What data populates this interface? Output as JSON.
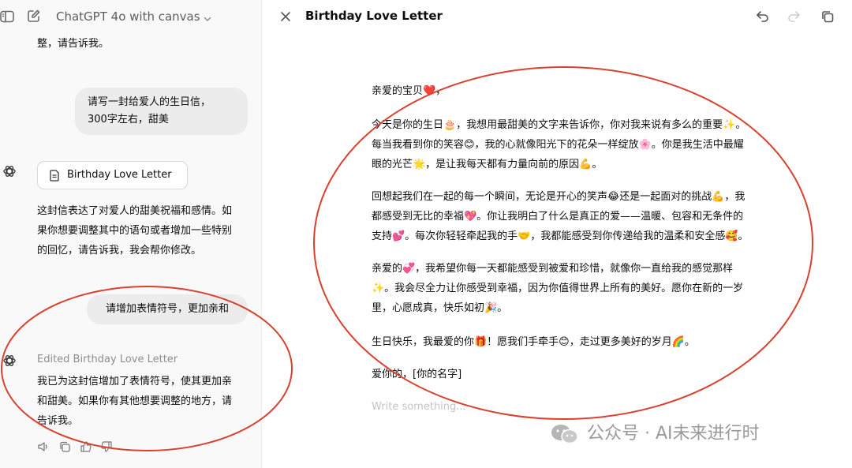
{
  "chat": {
    "model_name": "ChatGPT 4o with canvas",
    "prev_message_tail": "整，请告诉我。",
    "messages": {
      "user_1": [
        "请写一封给爱人的生日信，",
        "300字左右，甜美"
      ],
      "doc_card_label": "Birthday Love Letter",
      "assistant_1": [
        "这封信表达了对爱人的甜美祝福和感情。如",
        "果你想要调整其中的语句或者增加一些特别",
        "的回忆，请告诉我，我会帮你修改。"
      ],
      "user_2": "请增加表情符号，更加亲和",
      "edited_label": "Edited Birthday Love Letter",
      "assistant_2": [
        "我已为这封信增加了表情符号，使其更加亲",
        "和甜美。如果你有其他想要调整的地方，请",
        "告诉我。"
      ]
    },
    "actions": [
      "speaker-icon",
      "copy-icon",
      "thumbs-up-icon",
      "thumbs-down-icon"
    ]
  },
  "canvas": {
    "title": "Birthday Love Letter",
    "letter": {
      "greeting": "亲爱的宝贝❤️，",
      "p1": [
        "今天是你的生日🎂，我想用最甜美的文字来告诉你，你对我来说有多么的重要✨。",
        "每当我看到你的笑容😊，我的心就像阳光下的花朵一样绽放🌸。你是我生活中最耀",
        "眼的光芒🌟，是让我每天都有力量向前的原因💪。"
      ],
      "p2": [
        "回想起我们在一起的每一个瞬间，无论是开心的笑声😂还是一起面对的挑战💪，我",
        "都感受到无比的幸福💖。你让我明白了什么是真正的爱——温暖、包容和无条件的",
        "支持💕。每次你轻轻牵起我的手🤝，我都能感受到你传递给我的温柔和安全感🥰。"
      ],
      "p3": [
        "亲爱的💞，我希望你每一天都能感受到被爱和珍惜，就像你一直给我的感觉那样",
        "✨。我会尽全力让你感受到幸福，因为你值得世界上所有的美好。愿你在新的一岁",
        "里，心愿成真，快乐如初🎉。"
      ],
      "p4": "生日快乐，我最爱的你🎁！愿我们手牵手😊，走过更多美好的岁月🌈。",
      "signoff": "爱你的，[你的名字]"
    },
    "placeholder": "Write something..."
  },
  "watermark": "公众号 · AI未来进行时",
  "colors": {
    "annotation_red": "#d9412e",
    "sidebar_bg": "#f9f9f9",
    "bubble_bg": "#ececec"
  }
}
